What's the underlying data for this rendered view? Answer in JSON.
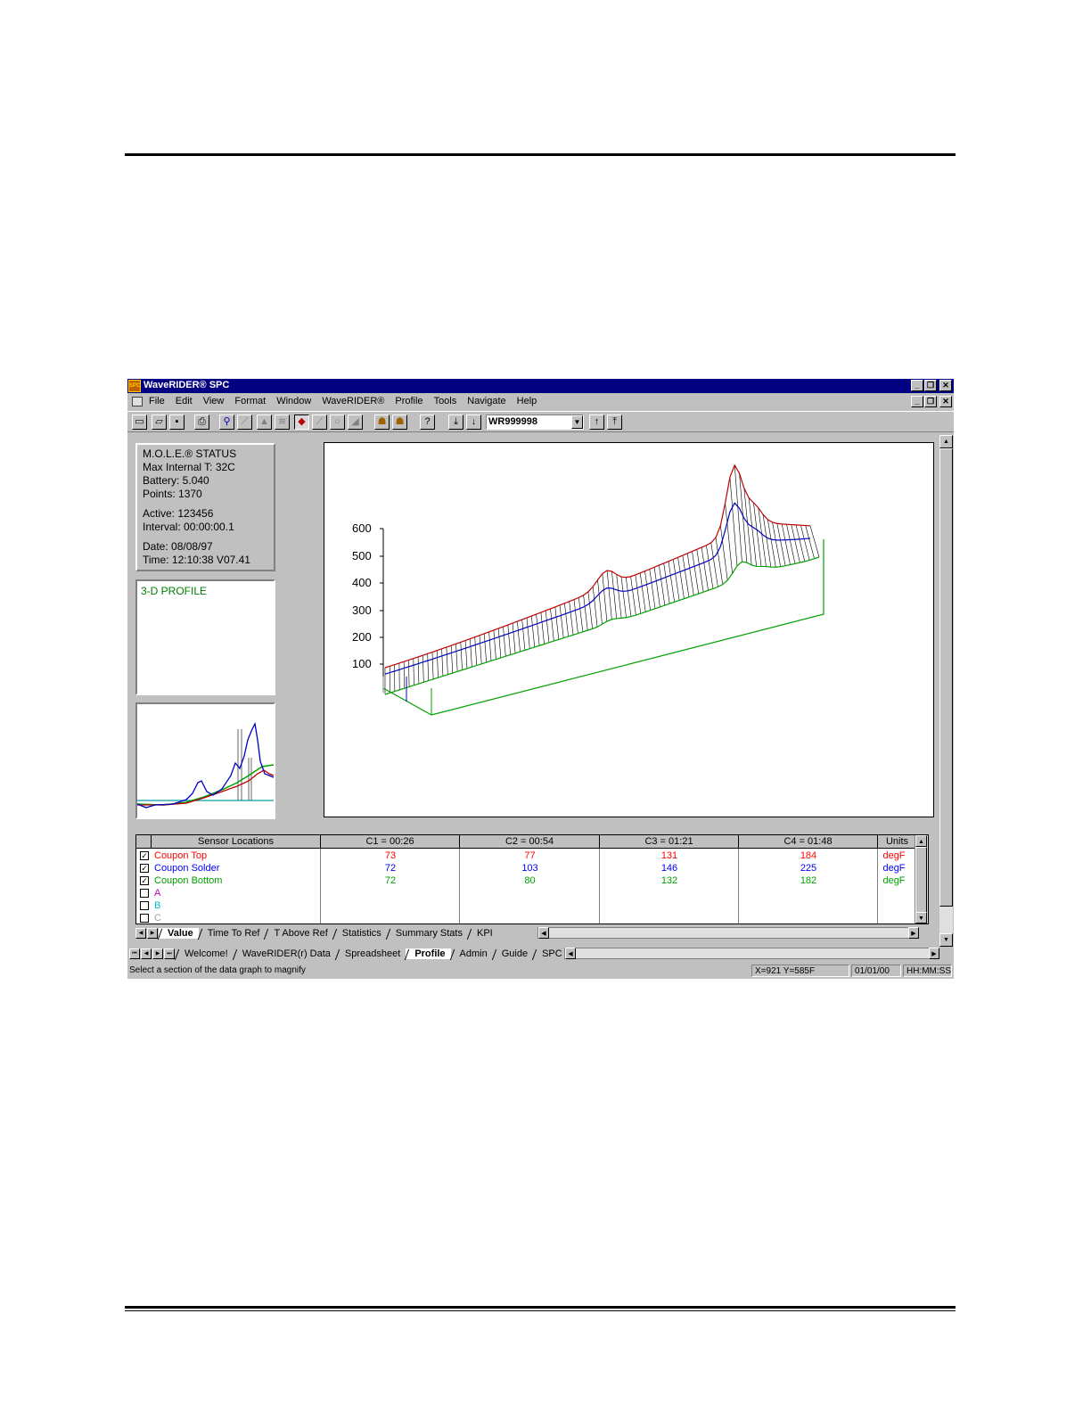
{
  "window": {
    "title": "WaveRIDER® SPC",
    "icon_label": "SPC"
  },
  "menu": [
    "File",
    "Edit",
    "View",
    "Format",
    "Window",
    "WaveRIDER®",
    "Profile",
    "Tools",
    "Navigate",
    "Help"
  ],
  "toolbar": {
    "profile_select": "WR999998"
  },
  "status": {
    "title": "M.O.L.E.® STATUS",
    "max_internal": "Max Internal T: 32C",
    "battery": "Battery: 5.040",
    "points": "Points: 1370",
    "active": "Active: 123456",
    "interval": "Interval: 00:00:00.1",
    "date": "Date: 08/08/97",
    "time": "Time: 12:10:38  V07.41"
  },
  "profile_label": "3-D PROFILE",
  "graph": {
    "y_ticks": [
      "600",
      "500",
      "400",
      "300",
      "200",
      "100"
    ]
  },
  "table": {
    "headers": [
      "Sensor Locations",
      "C1 = 00:26",
      "C2 = 00:54",
      "C3 = 01:21",
      "C4 = 01:48",
      "Units"
    ],
    "rows": [
      {
        "name": "Coupon Top",
        "checked": true,
        "color": "#ff0000",
        "values": [
          "73",
          "77",
          "131",
          "184"
        ],
        "units": "degF"
      },
      {
        "name": "Coupon Solder",
        "checked": true,
        "color": "#0000ff",
        "values": [
          "72",
          "103",
          "146",
          "225"
        ],
        "units": "degF"
      },
      {
        "name": "Coupon Bottom",
        "checked": true,
        "color": "#00a000",
        "values": [
          "72",
          "80",
          "132",
          "182"
        ],
        "units": "degF"
      },
      {
        "name": "A",
        "checked": false,
        "color": "#c000c0",
        "values": [
          "",
          "",
          "",
          ""
        ],
        "units": ""
      },
      {
        "name": "B",
        "checked": false,
        "color": "#00c0c0",
        "values": [
          "",
          "",
          "",
          ""
        ],
        "units": ""
      },
      {
        "name": "C",
        "checked": false,
        "color": "#a0a0a0",
        "values": [
          "",
          "",
          "",
          ""
        ],
        "units": ""
      }
    ]
  },
  "inner_tabs": [
    "Value",
    "Time To Ref",
    "T Above Ref",
    "Statistics",
    "Summary Stats",
    "KPI"
  ],
  "outer_tabs": [
    "Welcome!",
    "WaveRIDER(r) Data",
    "Spreadsheet",
    "Profile",
    "Admin",
    "Guide",
    "SPC"
  ],
  "statusbar": {
    "message": "Select a section of the data graph to magnify",
    "coords": "X=921 Y=585F",
    "date": "01/01/00",
    "time": "HH:MM:SS"
  }
}
